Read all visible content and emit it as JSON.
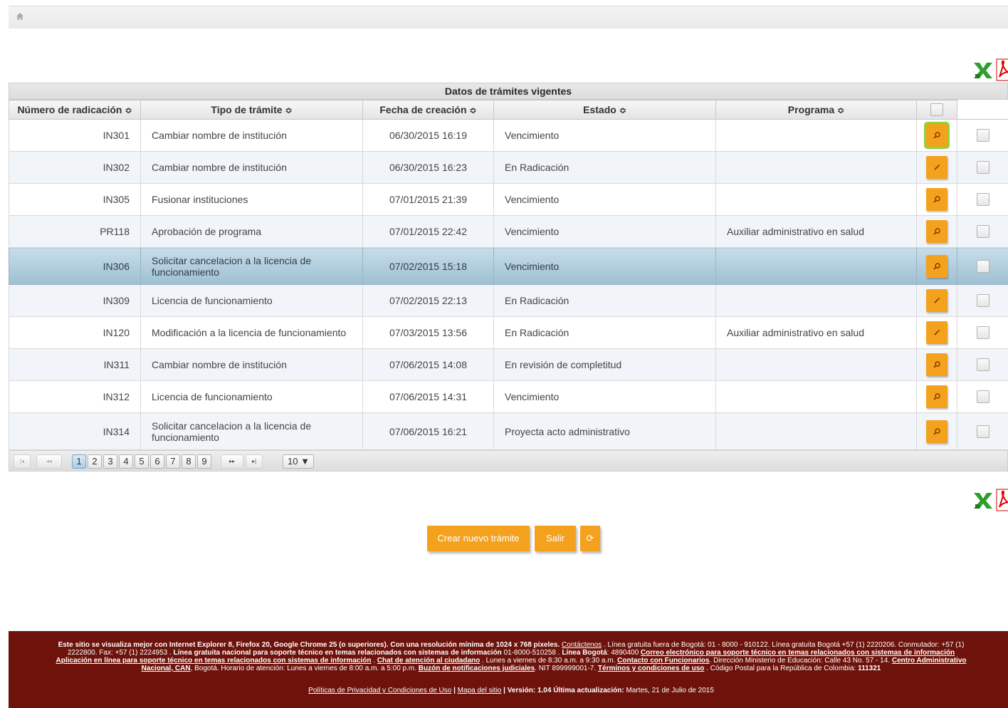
{
  "breadcrumb": {
    "home_icon": "home-icon"
  },
  "grid": {
    "caption": "Datos de trámites vigentes",
    "columns": [
      "Número de radicación",
      "Tipo de trámite",
      "Fecha de creación",
      "Estado",
      "Programa"
    ],
    "sort_glyph": "≎",
    "rows": [
      {
        "numero": "IN301",
        "tipo": "Cambiar nombre de institución",
        "fecha": "06/30/2015 16:19",
        "estado": "Vencimiento",
        "programa": "",
        "action": "search"
      },
      {
        "numero": "IN302",
        "tipo": "Cambiar nombre de institución",
        "fecha": "06/30/2015 16:23",
        "estado": "En Radicación",
        "programa": "",
        "action": "edit"
      },
      {
        "numero": "IN305",
        "tipo": "Fusionar instituciones",
        "fecha": "07/01/2015 21:39",
        "estado": "Vencimiento",
        "programa": "",
        "action": "search"
      },
      {
        "numero": "PR118",
        "tipo": "Aprobación de programa",
        "fecha": "07/01/2015 22:42",
        "estado": "Vencimiento",
        "programa": "Auxiliar administrativo en salud",
        "action": "search"
      },
      {
        "numero": "IN306",
        "tipo": "Solicitar cancelacion a la licencia de funcionamiento",
        "fecha": "07/02/2015 15:18",
        "estado": "Vencimiento",
        "programa": "",
        "action": "search"
      },
      {
        "numero": "IN309",
        "tipo": "Licencia de funcionamiento",
        "fecha": "07/02/2015 22:13",
        "estado": "En Radicación",
        "programa": "",
        "action": "edit"
      },
      {
        "numero": "IN120",
        "tipo": "Modificación a la licencia de funcionamiento",
        "fecha": "07/03/2015 13:56",
        "estado": "En Radicación",
        "programa": "Auxiliar administrativo en salud",
        "action": "edit"
      },
      {
        "numero": "IN311",
        "tipo": "Cambiar nombre de institución",
        "fecha": "07/06/2015 14:08",
        "estado": "En revisión de completitud",
        "programa": "",
        "action": "search"
      },
      {
        "numero": "IN312",
        "tipo": "Licencia de funcionamiento",
        "fecha": "07/06/2015 14:31",
        "estado": "Vencimiento",
        "programa": "",
        "action": "search"
      },
      {
        "numero": "IN314",
        "tipo": "Solicitar cancelacion a la licencia de funcionamiento",
        "fecha": "07/06/2015 16:21",
        "estado": "Proyecta acto administrativo",
        "programa": "",
        "action": "search"
      }
    ]
  },
  "pager": {
    "first": "|◂",
    "prev": "◂◂",
    "next": "▸▸",
    "last": "▸|",
    "pages": [
      "1",
      "2",
      "3",
      "4",
      "5",
      "6",
      "7",
      "8",
      "9"
    ],
    "current": "1",
    "rows_per_page": "10 ▼"
  },
  "buttons": {
    "create": "Crear nuevo trámite",
    "exit": "Salir",
    "refresh_icon": "refresh-icon",
    "refresh": "⟳"
  },
  "colors": {
    "accent": "#f4a21e",
    "footer": "#6d130c",
    "selected_row": "#aecbdd",
    "highlight": "#8dd33a"
  },
  "footer": {
    "l1a": "Este sitio se visualiza mejor con Internet Explorer 8, Firefox 20, Google Chrome 25 (o superiores). Con una resolución mínima de 1024 x 768 pixeles. ",
    "l1link": "Contáctenos",
    "l1b": " . Línea gratuita fuera de Bogotá: 01 - 8000 - 910122. Línea gratuita Bogotá +57 (1) 2220206. Conmutador: +57 (1)",
    "l2a": "2222800. Fax: +57 (1) 2224953 . ",
    "l2b": "Línea gratuita nacional para soporte técnico en temas relacionados con sistemas de información",
    "l2c": " 01-8000-510258 . ",
    "l2d": "Línea Bogotá",
    "l2e": ": 4890400 ",
    "l2link": "Correo electrónico para soporte técnico en temas relacionados con sistemas de información",
    "l3link1": "Aplicación en línea para soporte técnico en temas relacionados con sistemas de información",
    "l3a": " . ",
    "l3link2": "Chat de atención al ciudadano",
    "l3b": " . Lunes a viernes de 8:30 a.m. a 9:30 a.m. ",
    "l3link3": "Contacto con Funcionarios",
    "l3c": ". Dirección Ministerio de Educación: Calle 43 No. 57 - 14. ",
    "l3link4": "Centro Administrativo",
    "l4link1": "Nacional, CAN",
    "l4a": ", Bogotá. Horario de atención: Lunes a viernes de 8:00 a.m. a 5:00 p.m. ",
    "l4link2": "Buzón de notificaciones judiciales",
    "l4b": ". NIT 899999001-7. ",
    "l4link3": "Términos y condiciones de uso",
    "l4c": " . Código Postal para la República de Colombia: ",
    "l4d": "111321",
    "b_link1": "Políticas de Privacidad y Condiciones de Uso",
    "b_sep1": " | ",
    "b_link2": "Mapa del sitio",
    "b_sep2": " | ",
    "b_version_label": "Versión: 1.04 Última actualización:",
    "b_version_date": " Martes, 21 de Julio de 2015"
  }
}
